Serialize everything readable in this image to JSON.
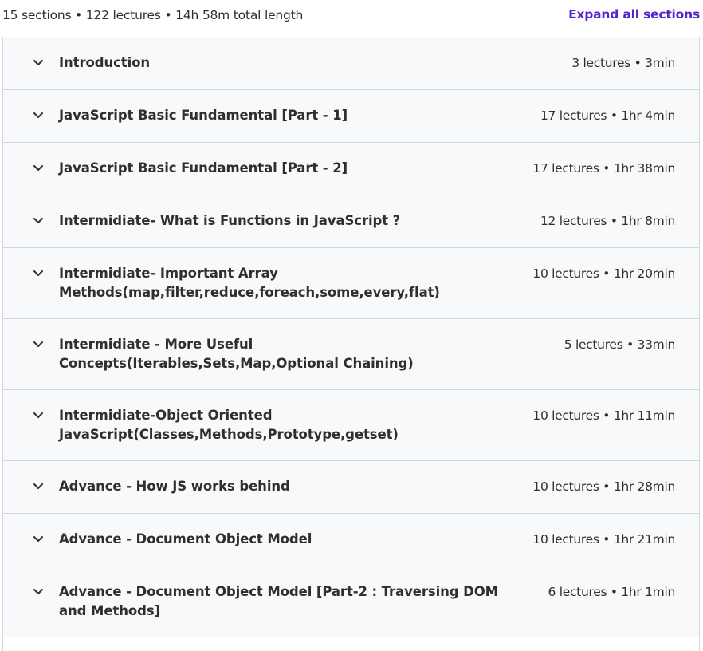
{
  "curriculum": {
    "summary": "15 sections • 122 lectures • 14h 58m total length",
    "expand_all_label": "Expand all sections",
    "icons": {
      "section_toggle": "chevron-down-icon"
    },
    "colors": {
      "link": "#5624d0",
      "row_background": "#f7f9fa",
      "border": "#d1d7dc"
    },
    "sections": [
      {
        "title": "Introduction",
        "meta": "3 lectures • 3min"
      },
      {
        "title": "JavaScript Basic Fundamental [Part - 1]",
        "meta": "17 lectures • 1hr 4min"
      },
      {
        "title": "JavaScript Basic Fundamental [Part - 2]",
        "meta": "17 lectures • 1hr 38min"
      },
      {
        "title": "Intermidiate- What is Functions in JavaScript ?",
        "meta": "12 lectures • 1hr 8min"
      },
      {
        "title": "Intermidiate- Important Array Methods(map,filter,reduce,foreach,some,every,flat)",
        "meta": "10 lectures • 1hr 20min"
      },
      {
        "title": "Intermidiate - More Useful Concepts(Iterables,Sets,Map,Optional Chaining)",
        "meta": "5 lectures • 33min"
      },
      {
        "title": "Intermidiate-Object Oriented JavaScript(Classes,Methods,Prototype,getset)",
        "meta": "10 lectures • 1hr 11min"
      },
      {
        "title": "Advance - How JS works behind",
        "meta": "10 lectures • 1hr 28min"
      },
      {
        "title": "Advance - Document Object Model",
        "meta": "10 lectures • 1hr 21min"
      },
      {
        "title": "Advance - Document Object Model [Part-2 : Traversing DOM and Methods]",
        "meta": "6 lectures • 1hr 1min"
      }
    ]
  }
}
